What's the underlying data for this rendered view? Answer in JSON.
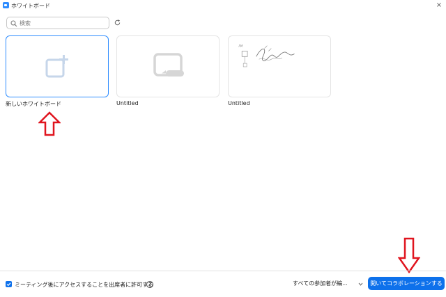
{
  "window": {
    "title": "ホワイトボード",
    "close_glyph": "×"
  },
  "search": {
    "placeholder": "検索",
    "value": ""
  },
  "cards": [
    {
      "label": "新しいホワイトボード",
      "thumbnail": "plus-square-icon"
    },
    {
      "label": "Untitled",
      "thumbnail": "whiteboard-icon"
    },
    {
      "label": "Untitled",
      "thumbnail": "sketch-thumbnail"
    }
  ],
  "footer": {
    "checkbox_label": "ミーティング後にアクセスすることを出席者に許可する",
    "checkbox_checked": true,
    "help_glyph": "?",
    "permission_value": "すべての参加者が編...",
    "primary_button_label": "開いてコラボレーションする"
  },
  "colors": {
    "accent": "#0e71eb",
    "selected_border": "#2d8cff",
    "annotation_arrow": "#e0141e"
  }
}
